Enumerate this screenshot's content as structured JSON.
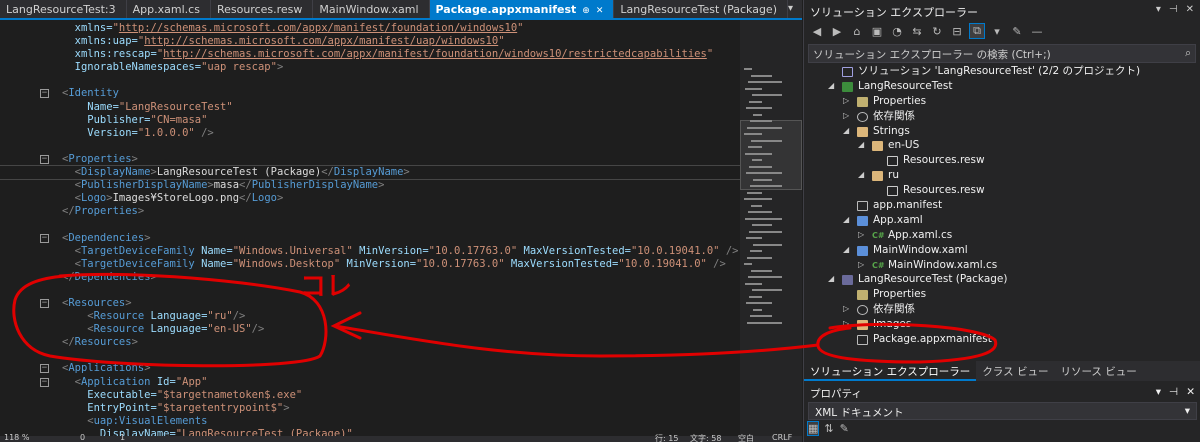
{
  "tabs": [
    {
      "label": "LangResourceTest:3"
    },
    {
      "label": "App.xaml.cs"
    },
    {
      "label": "Resources.resw"
    },
    {
      "label": "MainWindow.xaml"
    },
    {
      "label": "Package.appxmanifest",
      "active": true,
      "pin": "⊕",
      "close": "✕"
    },
    {
      "label": "LangResourceTest (Package)"
    }
  ],
  "code_lines": [
    [
      [
        "t-at",
        "  xmlns="
      ],
      [
        "t-val",
        "\""
      ],
      [
        "t-url",
        "http://schemas.microsoft.com/appx/manifest/foundation/windows10"
      ],
      [
        "t-val",
        "\""
      ]
    ],
    [
      [
        "t-at",
        "  xmlns:uap="
      ],
      [
        "t-val",
        "\""
      ],
      [
        "t-url",
        "http://schemas.microsoft.com/appx/manifest/uap/windows10"
      ],
      [
        "t-val",
        "\""
      ]
    ],
    [
      [
        "t-at",
        "  xmlns:rescap="
      ],
      [
        "t-val",
        "\""
      ],
      [
        "t-url",
        "http://schemas.microsoft.com/appx/manifest/foundation/windows10/restrictedcapabilities"
      ],
      [
        "t-val",
        "\""
      ]
    ],
    [
      [
        "t-at",
        "  IgnorableNamespaces="
      ],
      [
        "t-val",
        "\"uap rescap\""
      ],
      [
        "t-tag",
        ">"
      ]
    ],
    [],
    [
      [
        "t-tag",
        "<"
      ],
      [
        "t-el",
        "Identity"
      ]
    ],
    [
      [
        "t-at",
        "    Name="
      ],
      [
        "t-val",
        "\"LangResourceTest\""
      ]
    ],
    [
      [
        "t-at",
        "    Publisher="
      ],
      [
        "t-val",
        "\"CN=masa\""
      ]
    ],
    [
      [
        "t-at",
        "    Version="
      ],
      [
        "t-val",
        "\"1.0.0.0\""
      ],
      [
        "t-tag",
        " />"
      ]
    ],
    [],
    [
      [
        "t-tag",
        "<"
      ],
      [
        "t-el",
        "Properties"
      ],
      [
        "t-tag",
        ">"
      ]
    ],
    [
      [
        "t-tag",
        "  <"
      ],
      [
        "t-el",
        "DisplayName"
      ],
      [
        "t-tag",
        ">"
      ],
      [
        "t-txt",
        "LangResourceTest (Package)"
      ],
      [
        "t-tag",
        "</"
      ],
      [
        "t-el",
        "DisplayName"
      ],
      [
        "t-tag",
        ">"
      ]
    ],
    [
      [
        "t-tag",
        "  <"
      ],
      [
        "t-el",
        "PublisherDisplayName"
      ],
      [
        "t-tag",
        ">"
      ],
      [
        "t-txt",
        "masa"
      ],
      [
        "t-tag",
        "</"
      ],
      [
        "t-el",
        "PublisherDisplayName"
      ],
      [
        "t-tag",
        ">"
      ]
    ],
    [
      [
        "t-tag",
        "  <"
      ],
      [
        "t-el",
        "Logo"
      ],
      [
        "t-tag",
        ">"
      ],
      [
        "t-txt",
        "Images¥StoreLogo.png"
      ],
      [
        "t-tag",
        "</"
      ],
      [
        "t-el",
        "Logo"
      ],
      [
        "t-tag",
        ">"
      ]
    ],
    [
      [
        "t-tag",
        "</"
      ],
      [
        "t-el",
        "Properties"
      ],
      [
        "t-tag",
        ">"
      ]
    ],
    [],
    [
      [
        "t-tag",
        "<"
      ],
      [
        "t-el",
        "Dependencies"
      ],
      [
        "t-tag",
        ">"
      ]
    ],
    [
      [
        "t-tag",
        "  <"
      ],
      [
        "t-el",
        "TargetDeviceFamily"
      ],
      [
        "t-at",
        " Name="
      ],
      [
        "t-val",
        "\"Windows.Universal\""
      ],
      [
        "t-at",
        " MinVersion="
      ],
      [
        "t-val",
        "\"10.0.17763.0\""
      ],
      [
        "t-at",
        " MaxVersionTested="
      ],
      [
        "t-val",
        "\"10.0.19041.0\""
      ],
      [
        "t-tag",
        " />"
      ]
    ],
    [
      [
        "t-tag",
        "  <"
      ],
      [
        "t-el",
        "TargetDeviceFamily"
      ],
      [
        "t-at",
        " Name="
      ],
      [
        "t-val",
        "\"Windows.Desktop\""
      ],
      [
        "t-at",
        " MinVersion="
      ],
      [
        "t-val",
        "\"10.0.17763.0\""
      ],
      [
        "t-at",
        " MaxVersionTested="
      ],
      [
        "t-val",
        "\"10.0.19041.0\""
      ],
      [
        "t-tag",
        " />"
      ]
    ],
    [
      [
        "t-tag",
        "</"
      ],
      [
        "t-el",
        "Dependencies"
      ],
      [
        "t-tag",
        ">"
      ]
    ],
    [],
    [
      [
        "t-tag",
        "<"
      ],
      [
        "t-el",
        "Resources"
      ],
      [
        "t-tag",
        ">"
      ]
    ],
    [
      [
        "t-tag",
        "    <"
      ],
      [
        "t-el",
        "Resource"
      ],
      [
        "t-at",
        " Language="
      ],
      [
        "t-val",
        "\"ru\""
      ],
      [
        "t-tag",
        "/>"
      ]
    ],
    [
      [
        "t-tag",
        "    <"
      ],
      [
        "t-el",
        "Resource"
      ],
      [
        "t-at",
        " Language="
      ],
      [
        "t-val",
        "\"en-US\""
      ],
      [
        "t-tag",
        "/>"
      ]
    ],
    [
      [
        "t-tag",
        "</"
      ],
      [
        "t-el",
        "Resources"
      ],
      [
        "t-tag",
        ">"
      ]
    ],
    [],
    [
      [
        "t-tag",
        "<"
      ],
      [
        "t-el",
        "Applications"
      ],
      [
        "t-tag",
        ">"
      ]
    ],
    [
      [
        "t-tag",
        "  <"
      ],
      [
        "t-el",
        "Application"
      ],
      [
        "t-at",
        " Id="
      ],
      [
        "t-val",
        "\"App\""
      ]
    ],
    [
      [
        "t-at",
        "    Executable="
      ],
      [
        "t-val",
        "\"$targetnametoken$.exe\""
      ]
    ],
    [
      [
        "t-at",
        "    EntryPoint="
      ],
      [
        "t-val",
        "\"$targetentrypoint$\""
      ],
      [
        "t-tag",
        ">"
      ]
    ],
    [
      [
        "t-tag",
        "    <"
      ],
      [
        "t-el",
        "uap:VisualElements"
      ]
    ],
    [
      [
        "t-at",
        "      DisplayName="
      ],
      [
        "t-val",
        "\"LangResourceTest (Package)\""
      ]
    ]
  ],
  "fold_lines": [
    5,
    10,
    16,
    21,
    26,
    27
  ],
  "highlight_line": 11,
  "status": {
    "zoom": "118 %",
    "errors": "0",
    "warnings": "1",
    "line": "行: 15",
    "char": "文字: 58",
    "mode": "空白",
    "eol": "CRLF"
  },
  "solution_explorer": {
    "title": "ソリューション エクスプローラー",
    "search_placeholder": "ソリューション エクスプローラー の検索 (Ctrl+;)",
    "tree": [
      {
        "label": "ソリューション 'LangResourceTest' (2/2 のプロジェクト)",
        "icon": "sln",
        "indent": 0,
        "arrow": ""
      },
      {
        "label": "LangResourceTest",
        "icon": "proj",
        "indent": 0,
        "arrow": "◢"
      },
      {
        "label": "Properties",
        "icon": "prop",
        "indent": 1,
        "arrow": "▷"
      },
      {
        "label": "依存関係",
        "icon": "dep",
        "indent": 1,
        "arrow": "▷"
      },
      {
        "label": "Strings",
        "icon": "folder",
        "indent": 1,
        "arrow": "◢"
      },
      {
        "label": "en-US",
        "icon": "folder",
        "indent": 2,
        "arrow": "◢"
      },
      {
        "label": "Resources.resw",
        "icon": "resw",
        "indent": 3,
        "arrow": ""
      },
      {
        "label": "ru",
        "icon": "folder",
        "indent": 2,
        "arrow": "◢"
      },
      {
        "label": "Resources.resw",
        "icon": "resw",
        "indent": 3,
        "arrow": ""
      },
      {
        "label": "app.manifest",
        "icon": "manifest",
        "indent": 1,
        "arrow": ""
      },
      {
        "label": "App.xaml",
        "icon": "xaml",
        "indent": 1,
        "arrow": "◢"
      },
      {
        "label": "App.xaml.cs",
        "icon": "cs",
        "indent": 2,
        "arrow": "▷"
      },
      {
        "label": "MainWindow.xaml",
        "icon": "xaml",
        "indent": 1,
        "arrow": "◢"
      },
      {
        "label": "MainWindow.xaml.cs",
        "icon": "cs",
        "indent": 2,
        "arrow": "▷"
      },
      {
        "label": "LangResourceTest (Package)",
        "icon": "pkg",
        "indent": 0,
        "arrow": "◢"
      },
      {
        "label": "Properties",
        "icon": "prop",
        "indent": 1,
        "arrow": ""
      },
      {
        "label": "依存関係",
        "icon": "dep",
        "indent": 1,
        "arrow": "▷"
      },
      {
        "label": "Images",
        "icon": "folder",
        "indent": 1,
        "arrow": "▷"
      },
      {
        "label": "Package.appxmanifest",
        "icon": "manifest",
        "indent": 1,
        "arrow": ""
      }
    ],
    "bottom_tabs": [
      "ソリューション エクスプローラー",
      "クラス ビュー",
      "リソース ビュー"
    ]
  },
  "properties": {
    "title": "プロパティ",
    "selected": "XML ドキュメント"
  },
  "annotation_text": "コレ",
  "colors": {
    "accent": "#007acc",
    "annotation": "#e00000"
  }
}
